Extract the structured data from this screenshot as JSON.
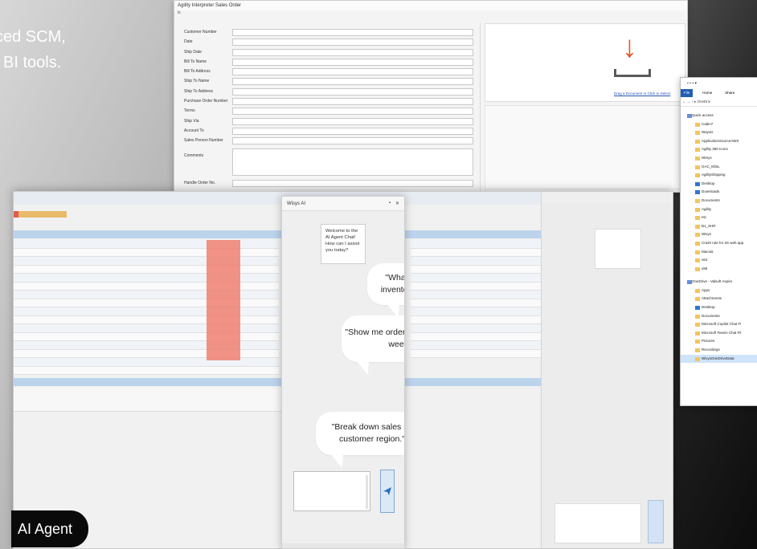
{
  "hero": {
    "line1": "ced SCM,",
    "line2": "l BI tools."
  },
  "sales_order": {
    "title": "Agility Interpreter Sales Order",
    "subtitle": "ls",
    "fields": [
      "Customer Number",
      "Date",
      "Ship Date",
      "Bill To Name",
      "Bill To Address",
      "Ship To Name",
      "Ship To Address",
      "Purchase Order Number",
      "Terms",
      "Ship Via",
      "Account To",
      "Sales Person Number"
    ],
    "comments_label": "Comments",
    "handle_label": "Handle Order No.",
    "drop_link": "Drag a Document or Click to Select"
  },
  "explorer": {
    "tabs": [
      "File",
      "Home",
      "Share"
    ],
    "path": "← → ↑ ▸ OneDriv",
    "quick_access_label": "Quick access",
    "quick_access": [
      "Cabin7",
      "Waysis",
      "ApplicationSourceAWS",
      "Agility 360 Icons",
      "WiSys",
      "GAC_MSIL",
      "AgilityShipping",
      "Desktop",
      "Downloads",
      "Documents",
      "Agility",
      "etc",
      "B1_SHR",
      "Wisys",
      "Crash rule for IIS web app",
      "Macola",
      "x64",
      "x86"
    ],
    "onedrive_label": "OneDrive - Valsoft Aspire",
    "onedrive": [
      "Apps",
      "Attachments",
      "Desktop",
      "Documents",
      "Microsoft Copilot Chat Fi",
      "Microsoft Teams Chat Fil",
      "Pictures",
      "Recordings",
      "WisysOneDriveData"
    ]
  },
  "chat": {
    "title": "Wisys AI",
    "controls": [
      "▪",
      "✕"
    ],
    "welcome": "Welcome to the AI Agent Chat! How can I assist you today?",
    "bubbles": [
      "\"What's our current inventory for Item X?\"",
      "\"Show me orders delayed this week.\"",
      "\"Break down sales by customer region.\""
    ]
  },
  "badge": {
    "label": "AI Agent"
  }
}
